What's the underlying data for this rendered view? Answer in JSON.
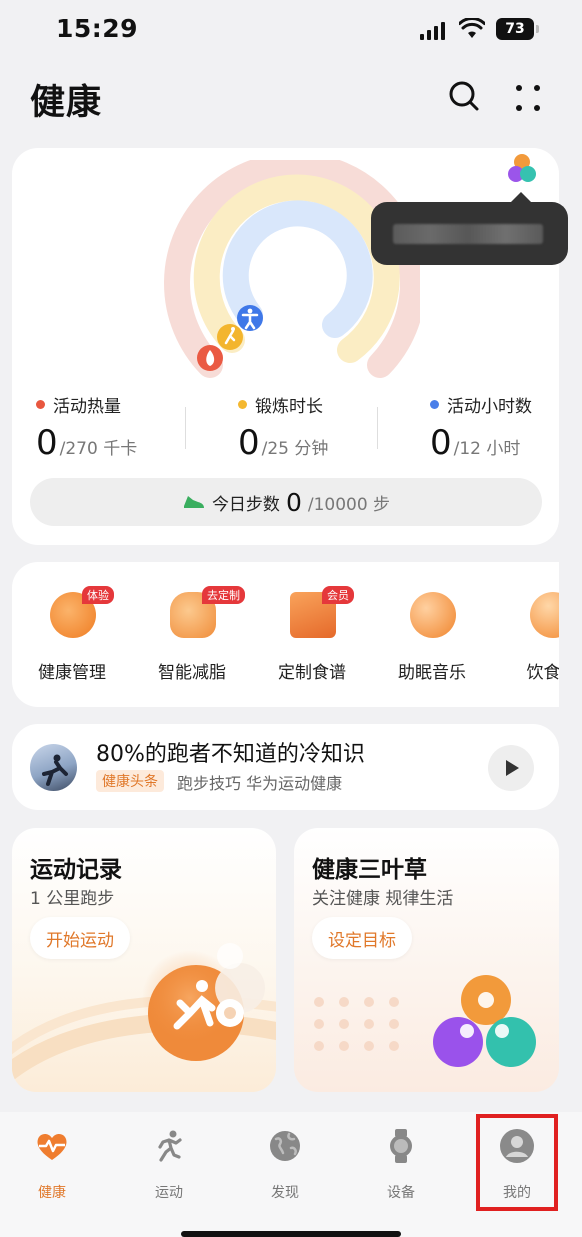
{
  "status_bar": {
    "time": "15:29",
    "battery": "73"
  },
  "header": {
    "title": "健康",
    "search_icon": "search-icon",
    "more_icon": "grid-dots-icon"
  },
  "activity": {
    "rings": [
      {
        "name": "活动热量",
        "color": "#f08a7a",
        "progress": 0
      },
      {
        "name": "锻炼时长",
        "color": "#f9d670",
        "progress": 0
      },
      {
        "name": "活动小时数",
        "color": "#8cb9f1",
        "progress": 0
      }
    ],
    "metrics": [
      {
        "label": "活动热量",
        "value": "0",
        "goal": "/270 千卡",
        "dot": "#e8573f"
      },
      {
        "label": "锻炼时长",
        "value": "0",
        "goal": "/25 分钟",
        "dot": "#f4b830"
      },
      {
        "label": "活动小时数",
        "value": "0",
        "goal": "/12 小时",
        "dot": "#4a7fe9"
      }
    ],
    "steps": {
      "label": "今日步数",
      "value": "0",
      "goal": "/10000 步"
    }
  },
  "services": [
    {
      "name": "健康管理",
      "badge": "体验",
      "icon": "doctor-icon"
    },
    {
      "name": "智能减脂",
      "badge": "去定制",
      "icon": "waist-icon"
    },
    {
      "name": "定制食谱",
      "badge": "会员",
      "icon": "recipe-book-icon"
    },
    {
      "name": "助眠音乐",
      "badge": "",
      "icon": "moon-music-icon"
    },
    {
      "name": "饮食日",
      "badge": "",
      "icon": "food-bowl-icon"
    }
  ],
  "article": {
    "title": "80%的跑者不知道的冷知识",
    "tag": "健康头条",
    "subtitle": "跑步技巧 华为运动健康"
  },
  "exercise_card": {
    "title": "运动记录",
    "subtitle": "1 公里跑步",
    "button": "开始运动"
  },
  "clover_card": {
    "title": "健康三叶草",
    "subtitle": "关注健康 规律生活",
    "button": "设定目标"
  },
  "tabs": [
    {
      "label": "健康",
      "icon": "heart-pulse-icon",
      "active": true
    },
    {
      "label": "运动",
      "icon": "runner-icon",
      "active": false
    },
    {
      "label": "发现",
      "icon": "globe-icon",
      "active": false
    },
    {
      "label": "设备",
      "icon": "watch-icon",
      "active": false
    },
    {
      "label": "我的",
      "icon": "avatar-icon",
      "active": false
    }
  ],
  "colors": {
    "accent": "#e0782a",
    "highlight": "#e02020"
  }
}
